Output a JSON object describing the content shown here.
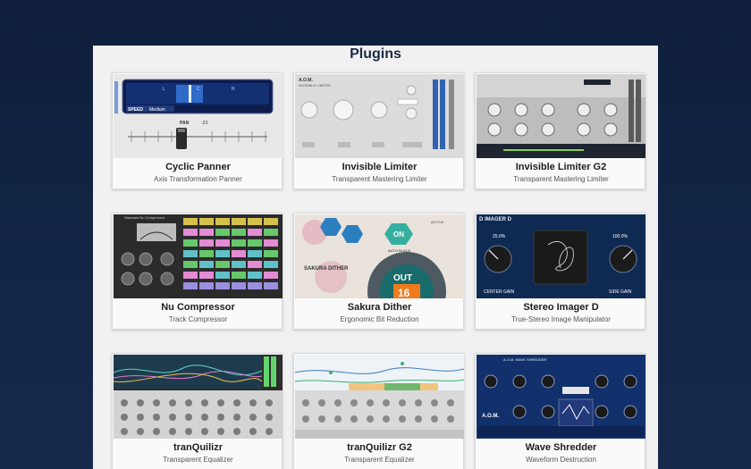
{
  "page": {
    "title": "Plugins"
  },
  "colors": {
    "background": "#0f1f3c",
    "panel": "#f1f1f1",
    "card": "#fafafa"
  },
  "plugins": [
    {
      "name": "Cyclic Panner",
      "description": "Axis Transformation Panner",
      "art": {
        "speed_label": "SPEED",
        "speed_value": "Medium",
        "pan_label": "PAN",
        "pan_value": "-23",
        "channels": [
          "L",
          "C",
          "R"
        ]
      }
    },
    {
      "name": "Invisible Limiter",
      "description": "Transparent Mastering Limiter",
      "art": {
        "brand": "A.O.M.",
        "subtitle": "INVISIBLE LIMITER"
      }
    },
    {
      "name": "Invisible Limiter G2",
      "description": "Transparent Mastering Limiter",
      "art": {}
    },
    {
      "name": "Nu Compressor",
      "description": "Track Compressor",
      "art": {
        "header": "Standard Nu Compressor"
      }
    },
    {
      "name": "Sakura Dither",
      "description": "Ergonomic Bit Reduction",
      "art": {
        "brand": "SAKURA DITHER",
        "on_label": "ON",
        "bits_label": "16",
        "out_label": "OUT",
        "noise_label": "AUTO BLACK",
        "active_label": "ACTIVE"
      }
    },
    {
      "name": "Stereo Imager D",
      "description": "True-Stereo Image Manipulator",
      "art": {
        "header": "D IMAGER D",
        "left_value": "25.0%",
        "right_value": "100.0%",
        "left_label": "CENTER GAIN",
        "right_label": "SIDE GAIN"
      }
    },
    {
      "name": "tranQuilizr",
      "description": "Transparent Equalizer",
      "art": {}
    },
    {
      "name": "tranQuilizr G2",
      "description": "Transparent Equalizer",
      "art": {}
    },
    {
      "name": "Wave Shredder",
      "description": "Waveform Destruction",
      "art": {
        "header": "A.O.M. WAVE SHREDDER",
        "brand": "A.O.M."
      }
    }
  ]
}
